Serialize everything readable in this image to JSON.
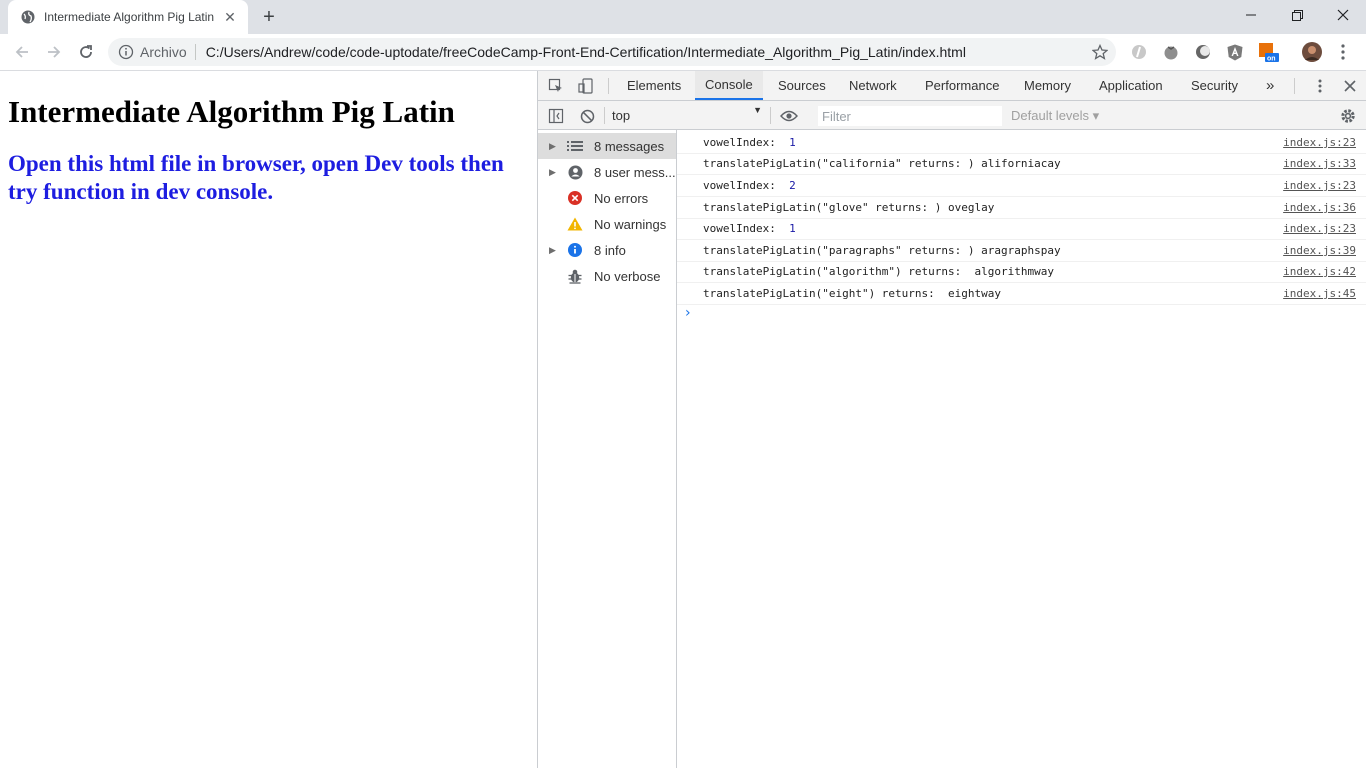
{
  "browser": {
    "tab_title": "Intermediate Algorithm Pig Latin",
    "scheme_label": "Archivo",
    "url": "C:/Users/Andrew/code/code-uptodate/freeCodeCamp-Front-End-Certification/Intermediate_Algorithm_Pig_Latin/index.html"
  },
  "page": {
    "heading": "Intermediate Algorithm Pig Latin",
    "subheading": "Open this html file in browser, open Dev tools then try function in dev console."
  },
  "devtools": {
    "tabs": [
      "Elements",
      "Console",
      "Sources",
      "Network",
      "Performance",
      "Memory",
      "Application",
      "Security"
    ],
    "active_tab": "Console",
    "more_tabs": "»",
    "context": "top",
    "filter_placeholder": "Filter",
    "levels_label": "Default levels ▾",
    "sidebar": [
      {
        "label": "8 messages",
        "icon": "list-icon"
      },
      {
        "label": "8 user mess...",
        "icon": "user-icon"
      },
      {
        "label": "No errors",
        "icon": "error-icon"
      },
      {
        "label": "No warnings",
        "icon": "warning-icon"
      },
      {
        "label": "8 info",
        "icon": "info-icon"
      },
      {
        "label": "No verbose",
        "icon": "bug-icon"
      }
    ],
    "messages": [
      {
        "text": "vowelIndex:  ",
        "num": "1",
        "src": "index.js:23"
      },
      {
        "text": "translatePigLatin(\"california\" returns: ) aliforniacay",
        "num": "",
        "src": "index.js:33"
      },
      {
        "text": "vowelIndex:  ",
        "num": "2",
        "src": "index.js:23"
      },
      {
        "text": "translatePigLatin(\"glove\" returns: ) oveglay",
        "num": "",
        "src": "index.js:36"
      },
      {
        "text": "vowelIndex:  ",
        "num": "1",
        "src": "index.js:23"
      },
      {
        "text": "translatePigLatin(\"paragraphs\" returns: ) aragraphspay",
        "num": "",
        "src": "index.js:39"
      },
      {
        "text": "translatePigLatin(\"algorithm\") returns:  algorithmway",
        "num": "",
        "src": "index.js:42"
      },
      {
        "text": "translatePigLatin(\"eight\") returns:  eightway",
        "num": "",
        "src": "index.js:45"
      }
    ],
    "prompt": "›"
  },
  "colors": {
    "accent": "#1a73e8",
    "heading_blue": "#1d1de0",
    "error": "#d93025",
    "warning": "#f2b600",
    "info": "#1a73e8"
  }
}
